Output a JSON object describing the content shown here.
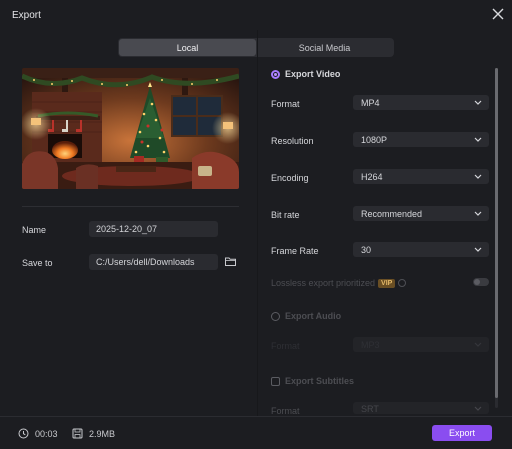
{
  "window": {
    "title": "Export"
  },
  "tabs": [
    {
      "label": "Local",
      "active": true
    },
    {
      "label": "Social Media",
      "active": false
    }
  ],
  "left": {
    "name_label": "Name",
    "name_value": "2025-12-20_07",
    "save_label": "Save to",
    "save_value": "C:/Users/dell/Downloads"
  },
  "export_video": {
    "label": "Export Video",
    "selected": true,
    "rows": [
      {
        "label": "Format",
        "value": "MP4"
      },
      {
        "label": "Resolution",
        "value": "1080P"
      },
      {
        "label": "Encoding",
        "value": "H264"
      },
      {
        "label": "Bit rate",
        "value": "Recommended"
      },
      {
        "label": "Frame Rate",
        "value": "30"
      }
    ],
    "lossless_label": "Lossless export prioritized",
    "vip_badge": "VIP",
    "lossless_enabled": false
  },
  "export_audio": {
    "label": "Export Audio",
    "selected": false,
    "format_label": "Format",
    "format_value": "MP3"
  },
  "export_subtitles": {
    "label": "Export Subtitles",
    "checked": false,
    "format_label": "Format",
    "format_value": "SRT"
  },
  "footer": {
    "duration": "00:03",
    "size": "2.9MB",
    "export_label": "Export"
  },
  "colors": {
    "accent": "#8a4df0",
    "background": "#1c1d21",
    "field": "#2a2b30"
  },
  "icons": [
    "close-icon",
    "folder-icon",
    "chevron-down-icon",
    "info-icon",
    "clock-icon",
    "disk-icon"
  ]
}
